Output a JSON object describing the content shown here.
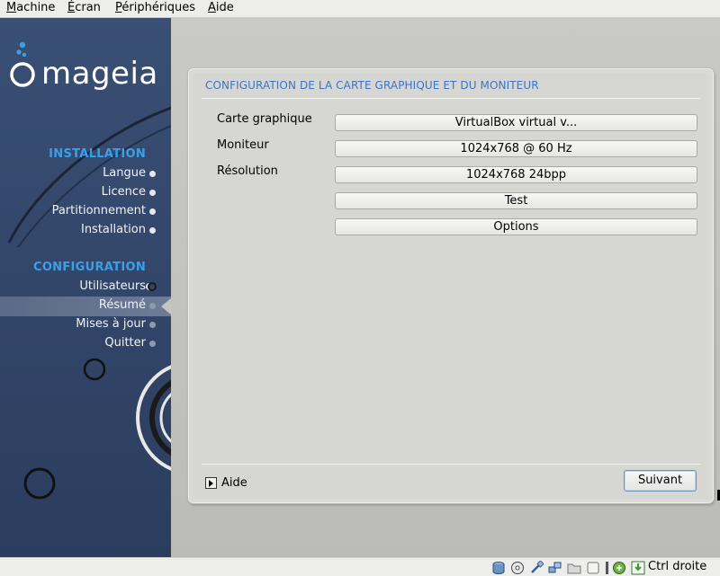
{
  "menubar": {
    "items": [
      {
        "first": "M",
        "rest": "achine"
      },
      {
        "first": "É",
        "rest": "cran"
      },
      {
        "first": "P",
        "rest": "ériphériques"
      },
      {
        "first": "A",
        "rest": "ide"
      }
    ]
  },
  "sidebar": {
    "logo": "mageia",
    "sections": [
      {
        "title": "INSTALLATION",
        "steps": [
          "Langue",
          "Licence",
          "Partitionnement",
          "Installation"
        ]
      },
      {
        "title": "CONFIGURATION",
        "steps": [
          "Utilisateurs",
          "Résumé",
          "Mises à jour",
          "Quitter"
        ]
      }
    ],
    "current_step": "Résumé"
  },
  "panel": {
    "title": "CONFIGURATION DE LA CARTE GRAPHIQUE ET DU MONITEUR",
    "fields": [
      {
        "label": "Carte graphique",
        "value": "VirtualBox virtual v..."
      },
      {
        "label": "Moniteur",
        "value": "1024x768 @ 60 Hz"
      },
      {
        "label": "Résolution",
        "value": "1024x768 24bpp"
      }
    ],
    "test_label": "Test",
    "options_label": "Options",
    "help_label": "Aide",
    "next_label": "Suivant"
  },
  "statusbar": {
    "host_key": "Ctrl droite",
    "icons": [
      "hard-disk-icon",
      "optical-drive-icon",
      "usb-icon",
      "network-icon",
      "shared-folder-icon",
      "display-icon",
      "capture-icon",
      "mouse-integration-icon",
      "host-key-icon"
    ]
  },
  "colors": {
    "sidebar_bg": "#33476b",
    "section_title": "#3aa0e8",
    "panel_title": "#3d74c8"
  }
}
